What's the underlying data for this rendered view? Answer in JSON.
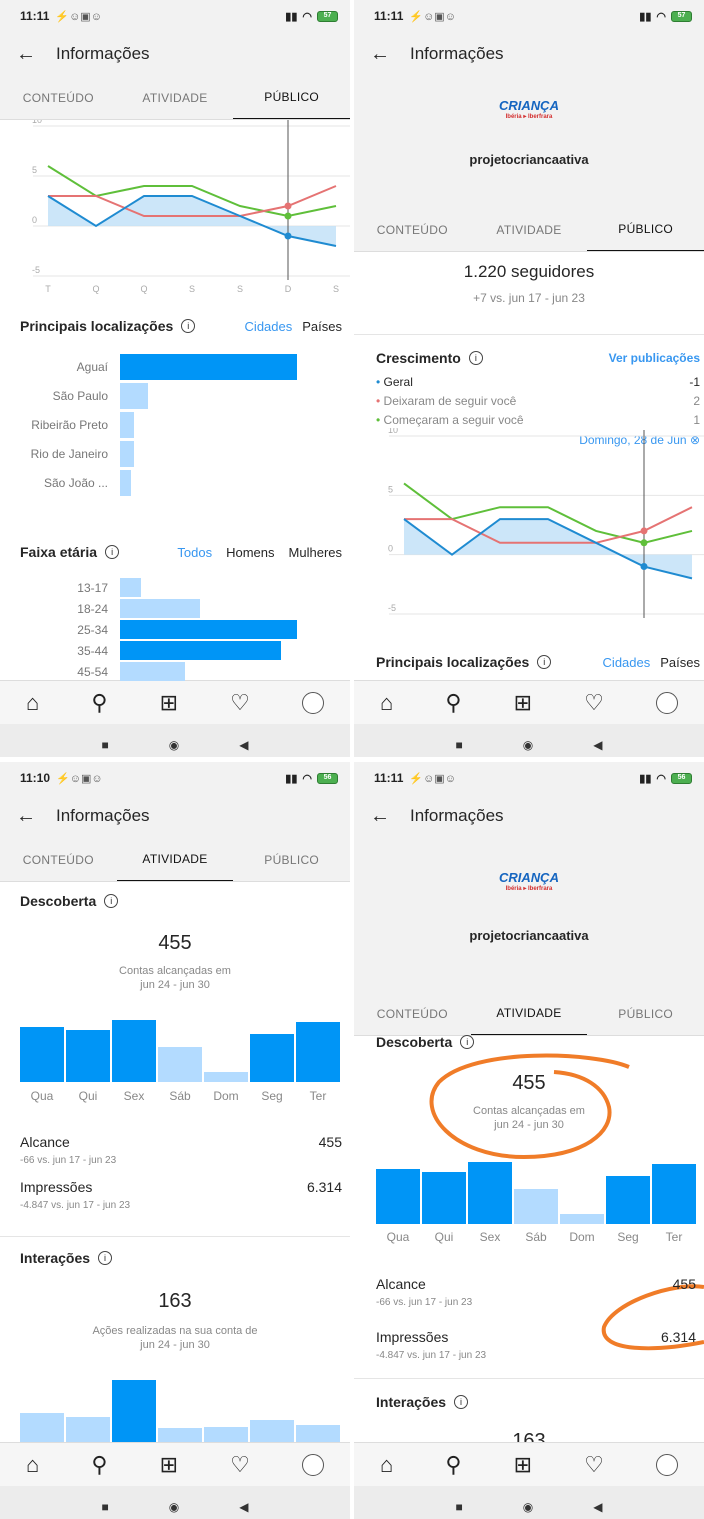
{
  "status": {
    "time_a": "11:11",
    "time_b": "11:10",
    "icons": "⚡☺▣☺",
    "battery_a": "57",
    "battery_b": "56"
  },
  "header": {
    "back": "←",
    "title": "Informações"
  },
  "tabs": [
    "CONTEÚDO",
    "ATIVIDADE",
    "PÚBLICO"
  ],
  "profile": {
    "username": "projetocriancaativa",
    "logo_top": "CRIANÇA",
    "logo_sub": "Ibéria ▸ Iberfrara"
  },
  "chart_data": [
    {
      "type": "line",
      "title": "Crescimento",
      "x": [
        "T",
        "Q",
        "Q",
        "S",
        "S",
        "D",
        "S"
      ],
      "ylim": [
        -5,
        10
      ],
      "yticks": [
        "10",
        "5",
        "0",
        "-5"
      ],
      "series": [
        {
          "name": "Geral",
          "color": "#1f8bd1",
          "values": [
            3,
            0,
            3,
            3,
            1,
            -1,
            -2
          ]
        },
        {
          "name": "Deixaram de seguir você",
          "color": "#e57373",
          "values": [
            3,
            3,
            1,
            1,
            1,
            2,
            4
          ]
        },
        {
          "name": "Começaram a seguir você",
          "color": "#5fbf3a",
          "values": [
            6,
            3,
            4,
            4,
            2,
            1,
            2
          ]
        }
      ],
      "highlight_index": 5
    }
  ],
  "followers": {
    "count": "1.220 seguidores",
    "delta": "+7 vs. jun 17 - jun 23"
  },
  "growth": {
    "title": "Crescimento",
    "link": "Ver publicações",
    "date": "Domingo, 28 de Jun",
    "rows": [
      {
        "label": "Geral",
        "value": "-1",
        "color": "#1f8bd1"
      },
      {
        "label": "Deixaram de seguir você",
        "value": "2",
        "color": "#e57373"
      },
      {
        "label": "Começaram a seguir você",
        "value": "1",
        "color": "#5fbf3a"
      }
    ]
  },
  "locations": {
    "title": "Principais localizações",
    "cities": "Cidades",
    "countries": "Países",
    "items": [
      {
        "label": "Aguaí",
        "value": 100,
        "light": false
      },
      {
        "label": "São Paulo",
        "value": 16,
        "light": true
      },
      {
        "label": "Ribeirão Preto",
        "value": 8,
        "light": true
      },
      {
        "label": "Rio de Janeiro",
        "value": 8,
        "light": true
      },
      {
        "label": "São João ...",
        "value": 6,
        "light": true
      }
    ]
  },
  "age": {
    "title": "Faixa etária",
    "all": "Todos",
    "men": "Homens",
    "women": "Mulheres",
    "items": [
      {
        "label": "13-17",
        "value": 12,
        "light": true
      },
      {
        "label": "18-24",
        "value": 45,
        "light": true
      },
      {
        "label": "25-34",
        "value": 100,
        "light": false
      },
      {
        "label": "35-44",
        "value": 91,
        "light": false
      },
      {
        "label": "45-54",
        "value": 37,
        "light": true
      }
    ]
  },
  "discovery": {
    "title": "Descoberta",
    "reach": "455",
    "reach_sub1": "Contas alcançadas em",
    "reach_sub2": "jun 24 - jun 30",
    "days": [
      "Qua",
      "Qui",
      "Sex",
      "Sáb",
      "Dom",
      "Seg",
      "Ter"
    ],
    "values": [
      88,
      84,
      100,
      56,
      16,
      78,
      97
    ],
    "light": [
      false,
      false,
      false,
      true,
      true,
      false,
      false
    ]
  },
  "metrics": {
    "alcance_label": "Alcance",
    "alcance": "455",
    "alcance_delta": "-66 vs. jun 17 - jun 23",
    "impressions_label": "Impressões",
    "impressions": "6.314",
    "impressions_delta": "-4.847 vs. jun 17 - jun 23"
  },
  "interactions": {
    "title": "Interações",
    "value": "163",
    "sub1": "Ações realizadas na sua conta de",
    "sub2": "jun 24 - jun 30",
    "values": [
      46,
      40,
      100,
      22,
      24,
      35,
      27
    ],
    "light": [
      true,
      true,
      false,
      true,
      true,
      true,
      true
    ]
  },
  "nav": {
    "home": "⌂",
    "search": "⚲",
    "add": "⊞",
    "heart": "♡"
  },
  "sys": {
    "square": "■",
    "circle": "◉",
    "back": "◀"
  }
}
